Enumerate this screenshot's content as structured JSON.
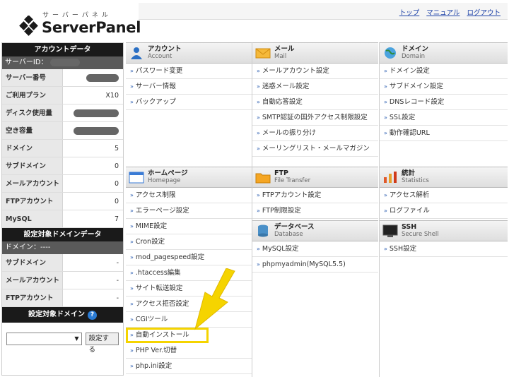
{
  "header": {
    "logo_kana": "サーバーパネル",
    "logo_text": "ServerPanel",
    "links": [
      "トップ",
      "マニュアル",
      "ログアウト"
    ]
  },
  "sidebar": {
    "account_title": "アカウントデータ",
    "server_id_label": "サーバーID：",
    "rows": [
      {
        "label": "サーバー番号",
        "value": "",
        "masked": true
      },
      {
        "label": "ご利用プラン",
        "value": "X10",
        "masked": false
      },
      {
        "label": "ディスク使用量",
        "value": "",
        "masked": true
      },
      {
        "label": "空き容量",
        "value": "",
        "masked": true
      },
      {
        "label": "ドメイン",
        "value": "5",
        "masked": false
      },
      {
        "label": "サブドメイン",
        "value": "0",
        "masked": false
      },
      {
        "label": "メールアカウント",
        "value": "0",
        "masked": false
      },
      {
        "label": "FTPアカウント",
        "value": "0",
        "masked": false
      },
      {
        "label": "MySQL",
        "value": "7",
        "masked": false
      }
    ],
    "domain_data_title": "設定対象ドメインデータ",
    "domain_label": "ドメイン：----",
    "domain_rows": [
      {
        "label": "サブドメイン",
        "value": "-"
      },
      {
        "label": "メールアカウント",
        "value": "-"
      },
      {
        "label": "FTPアカウント",
        "value": "-"
      }
    ],
    "target_domain_title": "設定対象ドメイン",
    "help_icon": "?",
    "set_button": "設定する"
  },
  "sections": {
    "account": {
      "jp": "アカウント",
      "en": "Account",
      "items": [
        "パスワード変更",
        "サーバー情報",
        "バックアップ"
      ]
    },
    "mail": {
      "jp": "メール",
      "en": "Mail",
      "items": [
        "メールアカウント設定",
        "迷惑メール設定",
        "自動応答設定",
        "SMTP認証の国外アクセス制限設定",
        "メールの振り分け",
        "メーリングリスト・メールマガジン"
      ]
    },
    "domain": {
      "jp": "ドメイン",
      "en": "Domain",
      "items": [
        "ドメイン設定",
        "サブドメイン設定",
        "DNSレコード設定",
        "SSL設定",
        "動作確認URL"
      ]
    },
    "homepage": {
      "jp": "ホームページ",
      "en": "Homepage",
      "items": [
        "アクセス制限",
        "エラーページ設定",
        "MIME設定",
        "Cron設定",
        "mod_pagespeed設定",
        ".htaccess編集",
        "サイト転送設定",
        "アクセス拒否設定",
        "CGIツール",
        "自動インストール",
        "PHP Ver.切替",
        "php.ini設定"
      ]
    },
    "ftp": {
      "jp": "FTP",
      "en": "File Transfer",
      "items": [
        "FTPアカウント設定",
        "FTP制限設定"
      ]
    },
    "stats": {
      "jp": "統計",
      "en": "Statistics",
      "items": [
        "アクセス解析",
        "ログファイル"
      ]
    },
    "database": {
      "jp": "データベース",
      "en": "Database",
      "items": [
        "MySQL設定",
        "phpmyadmin(MySQL5.5)"
      ]
    },
    "ssh": {
      "jp": "SSH",
      "en": "Secure Shell",
      "items": [
        "SSH設定"
      ]
    }
  },
  "colors": {
    "highlight": "#f5d400",
    "link": "#1a3fa6",
    "pointer_arrow": "#f5d400"
  },
  "icons": [
    "logo-diamond-icon",
    "account-icon",
    "mail-icon",
    "domain-globe-icon",
    "homepage-icon",
    "ftp-folder-icon",
    "stats-chart-icon",
    "database-icon",
    "ssh-terminal-icon",
    "yellow-pointer-arrow-icon"
  ]
}
